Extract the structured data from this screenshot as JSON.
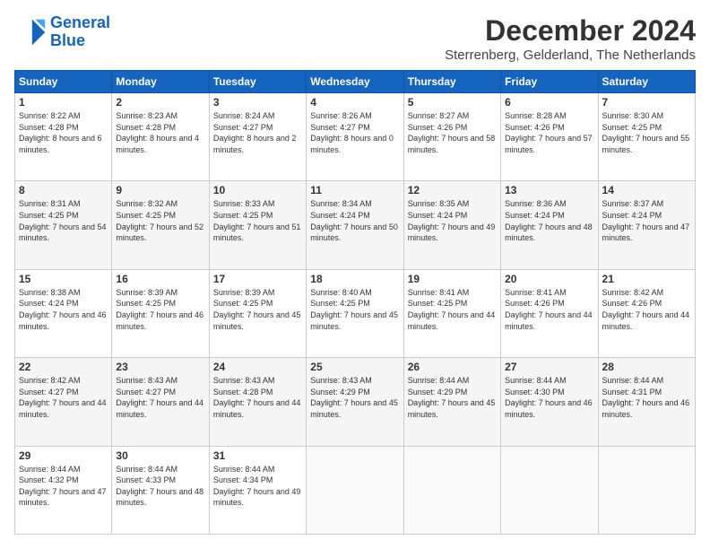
{
  "logo": {
    "line1": "General",
    "line2": "Blue"
  },
  "title": "December 2024",
  "subtitle": "Sterrenberg, Gelderland, The Netherlands",
  "weekdays": [
    "Sunday",
    "Monday",
    "Tuesday",
    "Wednesday",
    "Thursday",
    "Friday",
    "Saturday"
  ],
  "weeks": [
    [
      {
        "day": "1",
        "sunrise": "8:22 AM",
        "sunset": "4:28 PM",
        "daylight": "8 hours and 6 minutes"
      },
      {
        "day": "2",
        "sunrise": "8:23 AM",
        "sunset": "4:28 PM",
        "daylight": "8 hours and 4 minutes"
      },
      {
        "day": "3",
        "sunrise": "8:24 AM",
        "sunset": "4:27 PM",
        "daylight": "8 hours and 2 minutes"
      },
      {
        "day": "4",
        "sunrise": "8:26 AM",
        "sunset": "4:27 PM",
        "daylight": "8 hours and 0 minutes"
      },
      {
        "day": "5",
        "sunrise": "8:27 AM",
        "sunset": "4:26 PM",
        "daylight": "7 hours and 58 minutes"
      },
      {
        "day": "6",
        "sunrise": "8:28 AM",
        "sunset": "4:26 PM",
        "daylight": "7 hours and 57 minutes"
      },
      {
        "day": "7",
        "sunrise": "8:30 AM",
        "sunset": "4:25 PM",
        "daylight": "7 hours and 55 minutes"
      }
    ],
    [
      {
        "day": "8",
        "sunrise": "8:31 AM",
        "sunset": "4:25 PM",
        "daylight": "7 hours and 54 minutes"
      },
      {
        "day": "9",
        "sunrise": "8:32 AM",
        "sunset": "4:25 PM",
        "daylight": "7 hours and 52 minutes"
      },
      {
        "day": "10",
        "sunrise": "8:33 AM",
        "sunset": "4:25 PM",
        "daylight": "7 hours and 51 minutes"
      },
      {
        "day": "11",
        "sunrise": "8:34 AM",
        "sunset": "4:24 PM",
        "daylight": "7 hours and 50 minutes"
      },
      {
        "day": "12",
        "sunrise": "8:35 AM",
        "sunset": "4:24 PM",
        "daylight": "7 hours and 49 minutes"
      },
      {
        "day": "13",
        "sunrise": "8:36 AM",
        "sunset": "4:24 PM",
        "daylight": "7 hours and 48 minutes"
      },
      {
        "day": "14",
        "sunrise": "8:37 AM",
        "sunset": "4:24 PM",
        "daylight": "7 hours and 47 minutes"
      }
    ],
    [
      {
        "day": "15",
        "sunrise": "8:38 AM",
        "sunset": "4:24 PM",
        "daylight": "7 hours and 46 minutes"
      },
      {
        "day": "16",
        "sunrise": "8:39 AM",
        "sunset": "4:25 PM",
        "daylight": "7 hours and 46 minutes"
      },
      {
        "day": "17",
        "sunrise": "8:39 AM",
        "sunset": "4:25 PM",
        "daylight": "7 hours and 45 minutes"
      },
      {
        "day": "18",
        "sunrise": "8:40 AM",
        "sunset": "4:25 PM",
        "daylight": "7 hours and 45 minutes"
      },
      {
        "day": "19",
        "sunrise": "8:41 AM",
        "sunset": "4:25 PM",
        "daylight": "7 hours and 44 minutes"
      },
      {
        "day": "20",
        "sunrise": "8:41 AM",
        "sunset": "4:26 PM",
        "daylight": "7 hours and 44 minutes"
      },
      {
        "day": "21",
        "sunrise": "8:42 AM",
        "sunset": "4:26 PM",
        "daylight": "7 hours and 44 minutes"
      }
    ],
    [
      {
        "day": "22",
        "sunrise": "8:42 AM",
        "sunset": "4:27 PM",
        "daylight": "7 hours and 44 minutes"
      },
      {
        "day": "23",
        "sunrise": "8:43 AM",
        "sunset": "4:27 PM",
        "daylight": "7 hours and 44 minutes"
      },
      {
        "day": "24",
        "sunrise": "8:43 AM",
        "sunset": "4:28 PM",
        "daylight": "7 hours and 44 minutes"
      },
      {
        "day": "25",
        "sunrise": "8:43 AM",
        "sunset": "4:29 PM",
        "daylight": "7 hours and 45 minutes"
      },
      {
        "day": "26",
        "sunrise": "8:44 AM",
        "sunset": "4:29 PM",
        "daylight": "7 hours and 45 minutes"
      },
      {
        "day": "27",
        "sunrise": "8:44 AM",
        "sunset": "4:30 PM",
        "daylight": "7 hours and 46 minutes"
      },
      {
        "day": "28",
        "sunrise": "8:44 AM",
        "sunset": "4:31 PM",
        "daylight": "7 hours and 46 minutes"
      }
    ],
    [
      {
        "day": "29",
        "sunrise": "8:44 AM",
        "sunset": "4:32 PM",
        "daylight": "7 hours and 47 minutes"
      },
      {
        "day": "30",
        "sunrise": "8:44 AM",
        "sunset": "4:33 PM",
        "daylight": "7 hours and 48 minutes"
      },
      {
        "day": "31",
        "sunrise": "8:44 AM",
        "sunset": "4:34 PM",
        "daylight": "7 hours and 49 minutes"
      },
      null,
      null,
      null,
      null
    ]
  ]
}
